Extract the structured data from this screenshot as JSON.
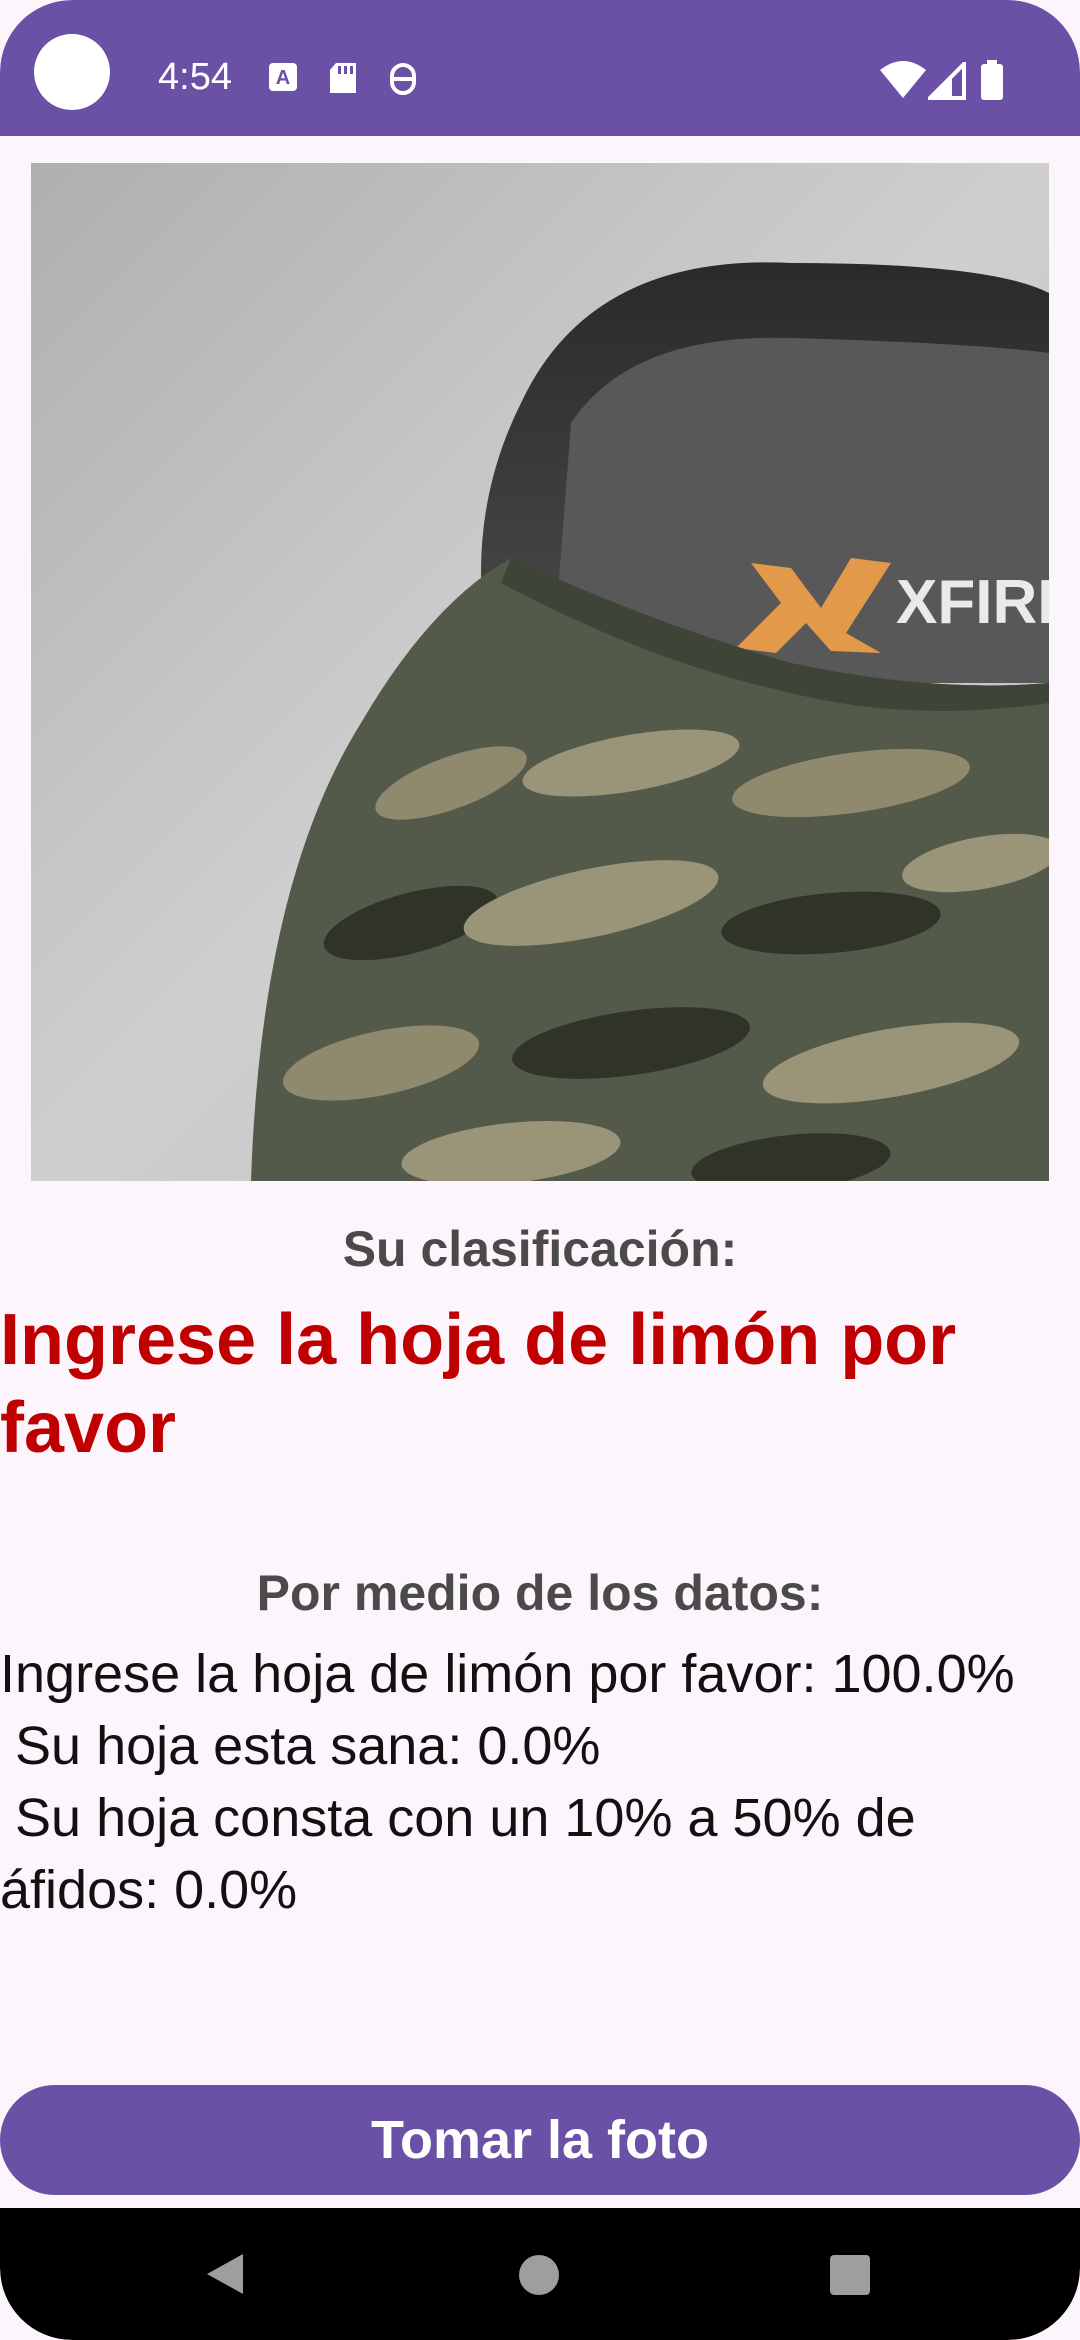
{
  "status_bar": {
    "time": "4:54",
    "color": "#6A51A6",
    "icons_left": [
      "keyboard-a-icon",
      "sd-card-icon",
      "accessibility-icon"
    ],
    "icons_right": [
      "wifi-icon",
      "signal-icon",
      "battery-icon"
    ]
  },
  "photo": {
    "description_icon": "captured-photo-image",
    "logo_text": "XFIRE"
  },
  "classification": {
    "label": "Su clasificación:",
    "result": "Ingrese la hoja de limón por favor",
    "result_color": "#C00000"
  },
  "data": {
    "label": "Por medio de los datos:",
    "details": "Ingrese la hoja de limón por favor: 100.0%\n Su hoja esta sana: 0.0%\n Su hoja consta con un 10% a 50% de áfidos: 0.0%"
  },
  "button": {
    "label": "Tomar la foto",
    "color": "#6A51A6"
  },
  "nav_bar": {
    "icons": [
      "back-icon",
      "home-icon",
      "recents-icon"
    ]
  }
}
